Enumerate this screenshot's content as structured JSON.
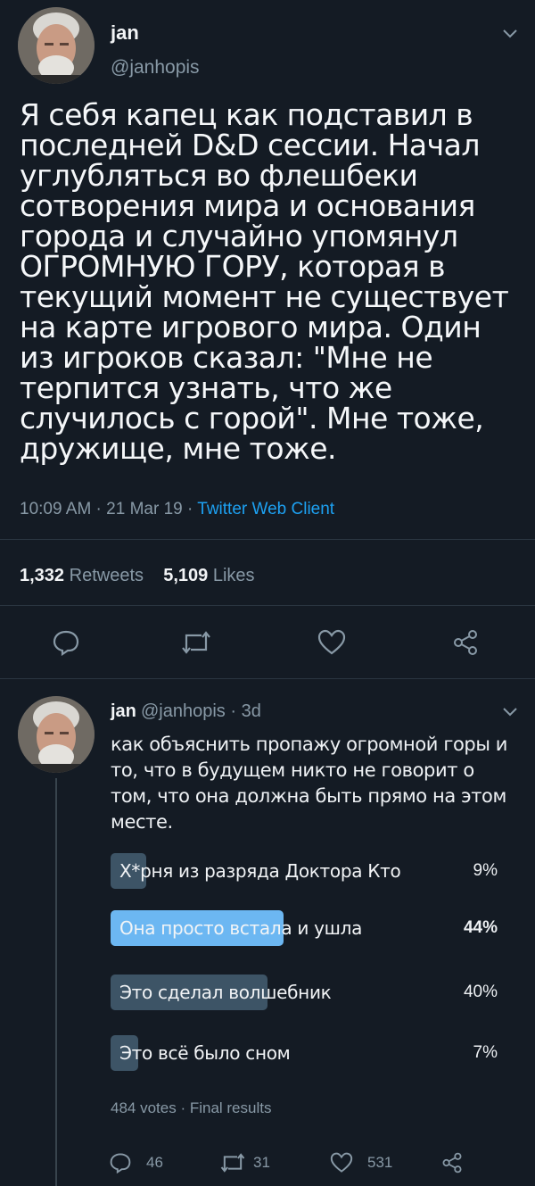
{
  "tweet": {
    "author_name": "jan",
    "author_handle": "@janhopis",
    "text": "Я себя капец как подставил в последней D&D сессии. Начал углубляться во флешбеки сотворения мира и основания города и случайно упомянул ОГРОМНУЮ ГОРУ, которая в текущий момент не существует на карте игрового мира. Один из игроков сказал: \"Мне не терпится узнать, что же случилось с горой\". Мне тоже, дружище, мне тоже.",
    "timestamp": "10:09 AM · 21 Mar 19 ·",
    "source": "Twitter Web Client",
    "retweets_count": "1,332",
    "retweets_label": "Retweets",
    "likes_count": "5,109",
    "likes_label": "Likes"
  },
  "reply": {
    "author_name": "jan",
    "author_handle": "@janhopis · 3d",
    "text": "как объяснить пропажу огромной горы и то, что в будущем никто не говорит о том, что она должна быть прямо на этом месте.",
    "poll": {
      "options": [
        {
          "label": "Х*рня из разряда Доктора Кто",
          "percent": "9%",
          "value": 9
        },
        {
          "label": "Она просто встала и ушла",
          "percent": "44%",
          "value": 44
        },
        {
          "label": "Это сделал волшебник",
          "percent": "40%",
          "value": 40
        },
        {
          "label": "Это всё было сном",
          "percent": "7%",
          "value": 7
        }
      ],
      "footer": "484 votes · Final results"
    },
    "replies_count": "46",
    "retweets_count": "31",
    "likes_count": "531"
  },
  "icons": {
    "reply": "speech-bubble-icon",
    "retweet": "retweet-arrows-icon",
    "like": "heart-icon",
    "share": "share-icon",
    "menu": "chevron-down-icon"
  },
  "colors": {
    "background": "#141b24",
    "accent": "#1da1f2",
    "winning_bar": "#6cb7f2",
    "bar": "#3d5466",
    "muted": "#8899a6"
  }
}
